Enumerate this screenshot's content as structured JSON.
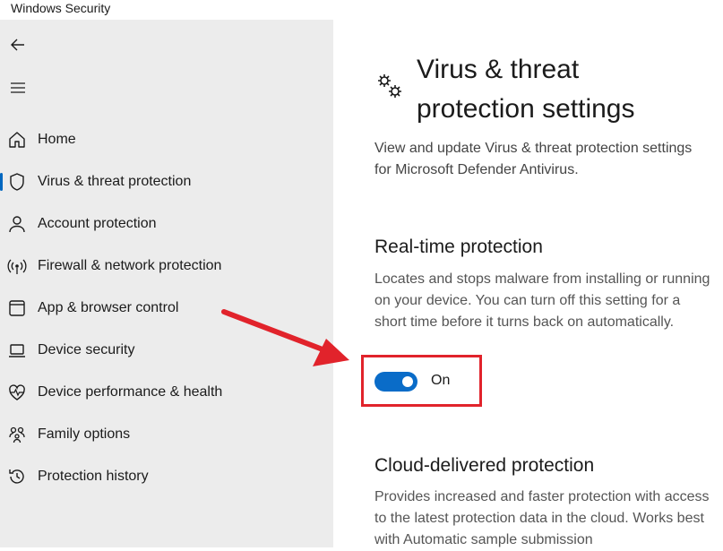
{
  "window": {
    "title": "Windows Security"
  },
  "nav": {
    "items": [
      {
        "label": "Home",
        "icon": "home-icon",
        "active": false
      },
      {
        "label": "Virus & threat protection",
        "icon": "shield-icon",
        "active": true
      },
      {
        "label": "Account protection",
        "icon": "person-icon",
        "active": false
      },
      {
        "label": "Firewall & network protection",
        "icon": "wireless-icon",
        "active": false
      },
      {
        "label": "App & browser control",
        "icon": "app-window-icon",
        "active": false
      },
      {
        "label": "Device security",
        "icon": "laptop-icon",
        "active": false
      },
      {
        "label": "Device performance & health",
        "icon": "heart-pulse-icon",
        "active": false
      },
      {
        "label": "Family options",
        "icon": "family-icon",
        "active": false
      },
      {
        "label": "Protection history",
        "icon": "history-icon",
        "active": false
      }
    ]
  },
  "main": {
    "title": "Virus & threat protection settings",
    "description": "View and update Virus & threat protection settings for Microsoft Defender Antivirus.",
    "realtime": {
      "title": "Real-time protection",
      "description": "Locates and stops malware from installing or running on your device. You can turn off this setting for a short time before it turns back on automatically.",
      "toggle_state": "On"
    },
    "cloud": {
      "title": "Cloud-delivered protection",
      "description": "Provides increased and faster protection with access to the latest protection data in the cloud. Works best with Automatic sample submission"
    }
  },
  "colors": {
    "accent": "#0a6cc8",
    "highlight": "#e1232b",
    "sidebar": "#ececec"
  }
}
